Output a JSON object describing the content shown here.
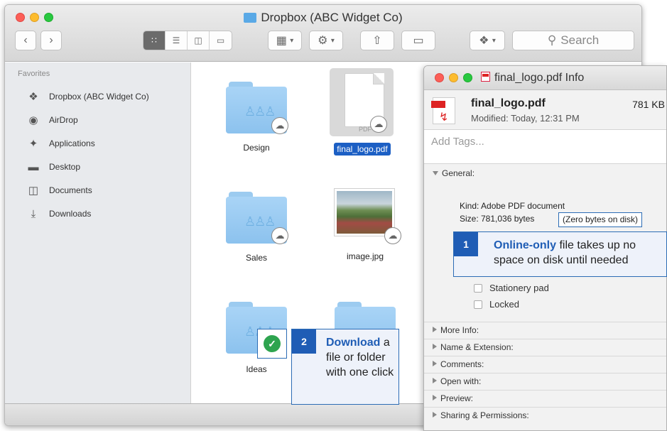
{
  "finder": {
    "title": "Dropbox (ABC Widget Co)",
    "search_label": "Search",
    "sidebar": {
      "heading": "Favorites",
      "items": [
        {
          "label": "Dropbox (ABC Widget Co)",
          "icon": "dropbox-icon"
        },
        {
          "label": "AirDrop",
          "icon": "airdrop-icon"
        },
        {
          "label": "Applications",
          "icon": "applications-icon"
        },
        {
          "label": "Desktop",
          "icon": "desktop-icon"
        },
        {
          "label": "Documents",
          "icon": "documents-icon"
        },
        {
          "label": "Downloads",
          "icon": "downloads-icon"
        }
      ]
    },
    "files": [
      {
        "name": "Design",
        "type": "folder"
      },
      {
        "name": "final_logo.pdf",
        "type": "pdf",
        "ext": "PDF",
        "selected": true
      },
      {
        "name": "Sales",
        "type": "folder"
      },
      {
        "name": "image.jpg",
        "type": "image"
      },
      {
        "name": "Ideas",
        "type": "folder"
      },
      {
        "name": "",
        "type": "folder"
      }
    ]
  },
  "info": {
    "title": "final_logo.pdf Info",
    "filename": "final_logo.pdf",
    "size": "781 KB",
    "modified": "Modified: Today, 12:31 PM",
    "tags_placeholder": "Add Tags...",
    "general_label": "General:",
    "kind": "Kind: Adobe PDF document",
    "size_bytes": "Size: 781,036 bytes",
    "zero_bytes": "(Zero bytes on disk)",
    "stationery": "Stationery pad",
    "locked": "Locked",
    "sections": [
      "More Info:",
      "Name & Extension:",
      "Comments:",
      "Open with:",
      "Preview:",
      "Sharing & Permissions:"
    ]
  },
  "callouts": {
    "one": {
      "num": "1",
      "highlight": "Online-only",
      "rest": " file takes up no space on disk until needed"
    },
    "two": {
      "num": "2",
      "highlight": "Download",
      "rest": " a file or folder with one click"
    }
  },
  "colors": {
    "accent": "#1f5db5",
    "selection": "#1c5fc4",
    "folder": "#8cc2ee",
    "check": "#2ea44f"
  }
}
